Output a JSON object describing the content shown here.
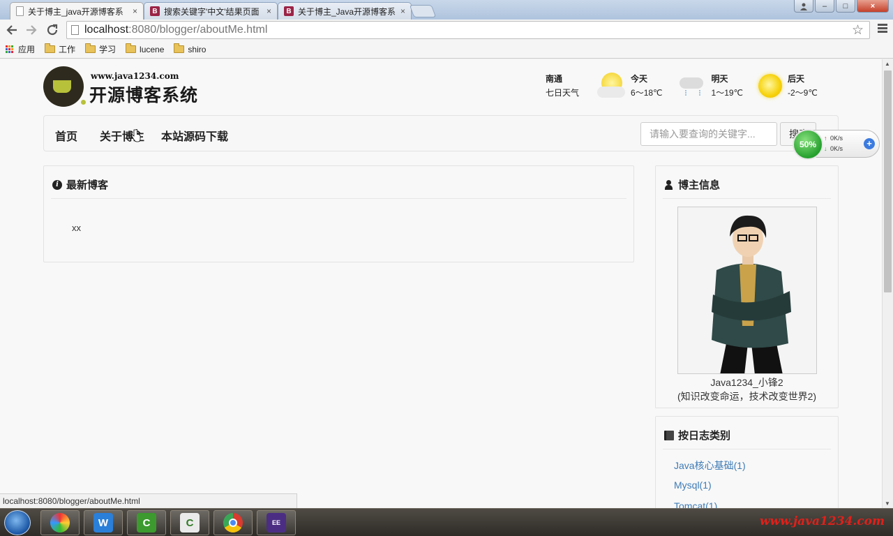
{
  "browser": {
    "tabs": [
      {
        "title": "关于博主_java开源博客系",
        "favicon": "doc-icon",
        "active": true
      },
      {
        "title": "搜索关键字'中文'结果页面",
        "favicon": "b-icon",
        "active": false
      },
      {
        "title": "关于博主_Java开源博客系",
        "favicon": "b-icon",
        "active": false
      }
    ],
    "tab_close": "×",
    "window_buttons": {
      "minimize": "–",
      "maximize": "□",
      "close": "×"
    },
    "url_host": "localhost",
    "url_rest": ":8080/blogger/aboutMe.html",
    "bookmarks": [
      {
        "label": "应用",
        "icon": "apps-grid-icon"
      },
      {
        "label": "工作",
        "icon": "folder-icon"
      },
      {
        "label": "学习",
        "icon": "folder-icon"
      },
      {
        "label": "lucene",
        "icon": "folder-icon"
      },
      {
        "label": "shiro",
        "icon": "folder-icon"
      }
    ],
    "status_url": "localhost:8080/blogger/aboutMe.html"
  },
  "header": {
    "site_url": "www.java1234.com",
    "site_name": "开源博客系统"
  },
  "weather": {
    "city": "南通",
    "label": "七日天气",
    "days": [
      {
        "day": "今天",
        "temp": "6～18℃",
        "icon": "sun-cloud-icon"
      },
      {
        "day": "明天",
        "temp": "1～19℃",
        "icon": "rain-cloud-icon"
      },
      {
        "day": "后天",
        "temp": "-2～9℃",
        "icon": "sun-icon"
      }
    ]
  },
  "nav": {
    "items": [
      "首页",
      "关于博主",
      "本站源码下载"
    ],
    "search_placeholder": "请输入要查询的关键字...",
    "search_button": "搜索"
  },
  "main_panel": {
    "title": "最新博客",
    "content": "xx"
  },
  "blogger_panel": {
    "title": "博主信息",
    "name": "Java1234_小锋2",
    "motto": "(知识改变命运，技术改变世界2)"
  },
  "category_panel": {
    "title": "按日志类别",
    "items": [
      "Java核心基础(1)",
      "Mysql(1)",
      "Tomcat(1)"
    ]
  },
  "net_meter": {
    "percent": "50%",
    "upload": "0K/s",
    "download": "0K/s"
  },
  "taskbar": {
    "tray_brand": "www.java1234.com"
  },
  "colors": {
    "link": "#3e7bb5",
    "tab_b_favicon": "#9b2446",
    "tray_brand": "#e0201a"
  }
}
